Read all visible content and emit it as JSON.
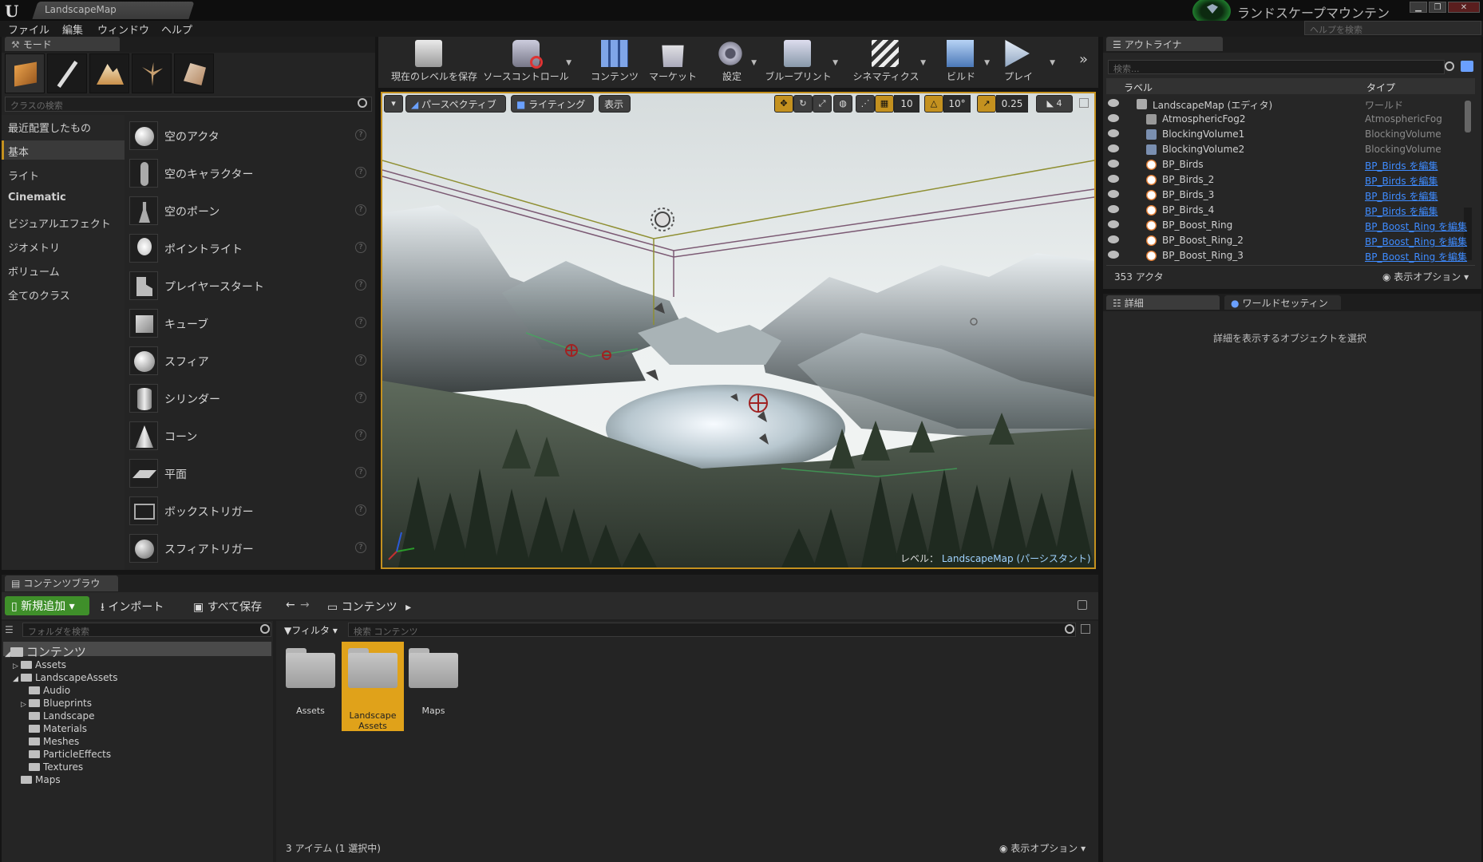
{
  "title_bar": {
    "tab": "LandscapeMap",
    "project_name": "ランドスケープマウンテン",
    "min": "▁",
    "max": "❐",
    "close": "✕"
  },
  "menu": [
    "ファイル",
    "編集",
    "ウィンドウ",
    "ヘルプ"
  ],
  "help_search_placeholder": "ヘルプを検索",
  "modes": {
    "tab": "モード",
    "search_placeholder": "クラスの検索",
    "categories": [
      "最近配置したもの",
      "基本",
      "ライト",
      "Cinematic",
      "ビジュアルエフェクト",
      "ジオメトリ",
      "ボリューム",
      "全てのクラス"
    ],
    "selected_category": "基本",
    "items": [
      "空のアクタ",
      "空のキャラクター",
      "空のポーン",
      "ポイントライト",
      "プレイヤースタート",
      "キューブ",
      "スフィア",
      "シリンダー",
      "コーン",
      "平面",
      "ボックストリガー",
      "スフィアトリガー"
    ],
    "help_glyph": "?"
  },
  "toolbar": [
    "現在のレベルを保存",
    "ソースコントロール",
    "コンテンツ",
    "マーケット",
    "設定",
    "ブループリント",
    "シネマティクス",
    "ビルド",
    "プレイ"
  ],
  "viewport": {
    "menu_arrow": "▾",
    "perspective": "パースペクティブ",
    "lighting": "ライティング",
    "show": "表示",
    "grid_snap": "10",
    "rotation_snap": "10°",
    "scale_snap": "0.25",
    "camera_speed": "4",
    "level_prefix": "レベル：",
    "level_name": "LandscapeMap (パーシスタント)"
  },
  "outliner": {
    "tab": "アウトライナ",
    "search_placeholder": "検索...",
    "col_label": "ラベル",
    "col_type": "タイプ",
    "rows": [
      {
        "label": "LandscapeMap (エディタ)",
        "type": "ワールド",
        "link": false
      },
      {
        "label": "AtmosphericFog2",
        "type": "AtmosphericFog",
        "link": false
      },
      {
        "label": "BlockingVolume1",
        "type": "BlockingVolume",
        "link": false
      },
      {
        "label": "BlockingVolume2",
        "type": "BlockingVolume",
        "link": false
      },
      {
        "label": "BP_Birds",
        "type": "BP_Birds を編集",
        "link": true
      },
      {
        "label": "BP_Birds_2",
        "type": "BP_Birds を編集",
        "link": true
      },
      {
        "label": "BP_Birds_3",
        "type": "BP_Birds を編集",
        "link": true
      },
      {
        "label": "BP_Birds_4",
        "type": "BP_Birds を編集",
        "link": true
      },
      {
        "label": "BP_Boost_Ring",
        "type": "BP_Boost_Ring を編集",
        "link": true
      },
      {
        "label": "BP_Boost_Ring_2",
        "type": "BP_Boost_Ring を編集",
        "link": true
      },
      {
        "label": "BP_Boost_Ring_3",
        "type": "BP_Boost_Ring を編集",
        "link": true
      }
    ],
    "actor_count": "353 アクタ",
    "view_options": "表示オプション"
  },
  "details": {
    "tab_details": "詳細",
    "tab_world": "ワールドセッティン",
    "empty_message": "詳細を表示するオブジェクトを選択"
  },
  "content_browser": {
    "tab": "コンテンツブラウ",
    "add_new": "新規追加",
    "import": "インポート",
    "save_all": "すべて保存",
    "path": "コンテンツ",
    "folder_search_placeholder": "フォルダを検索",
    "filter": "フィルタ",
    "search_placeholder": "検索 コンテンツ",
    "tree": [
      {
        "label": "コンテンツ",
        "depth": 0,
        "arrow": "◢"
      },
      {
        "label": "Assets",
        "depth": 1,
        "arrow": "▷"
      },
      {
        "label": "LandscapeAssets",
        "depth": 1,
        "arrow": "◢"
      },
      {
        "label": "Audio",
        "depth": 2,
        "arrow": ""
      },
      {
        "label": "Blueprints",
        "depth": 2,
        "arrow": "▷"
      },
      {
        "label": "Landscape",
        "depth": 2,
        "arrow": ""
      },
      {
        "label": "Materials",
        "depth": 2,
        "arrow": ""
      },
      {
        "label": "Meshes",
        "depth": 2,
        "arrow": ""
      },
      {
        "label": "ParticleEffects",
        "depth": 2,
        "arrow": ""
      },
      {
        "label": "Textures",
        "depth": 2,
        "arrow": ""
      },
      {
        "label": "Maps",
        "depth": 1,
        "arrow": ""
      }
    ],
    "tiles": [
      {
        "label": "Assets",
        "selected": false
      },
      {
        "label": "Landscape Assets",
        "selected": true
      },
      {
        "label": "Maps",
        "selected": false
      }
    ],
    "status": "3 アイテム (1 選択中)",
    "view_options": "表示オプション"
  },
  "colors": {
    "accent": "#c4911f",
    "link": "#3e8bff",
    "add_button": "#3f8f2a"
  }
}
